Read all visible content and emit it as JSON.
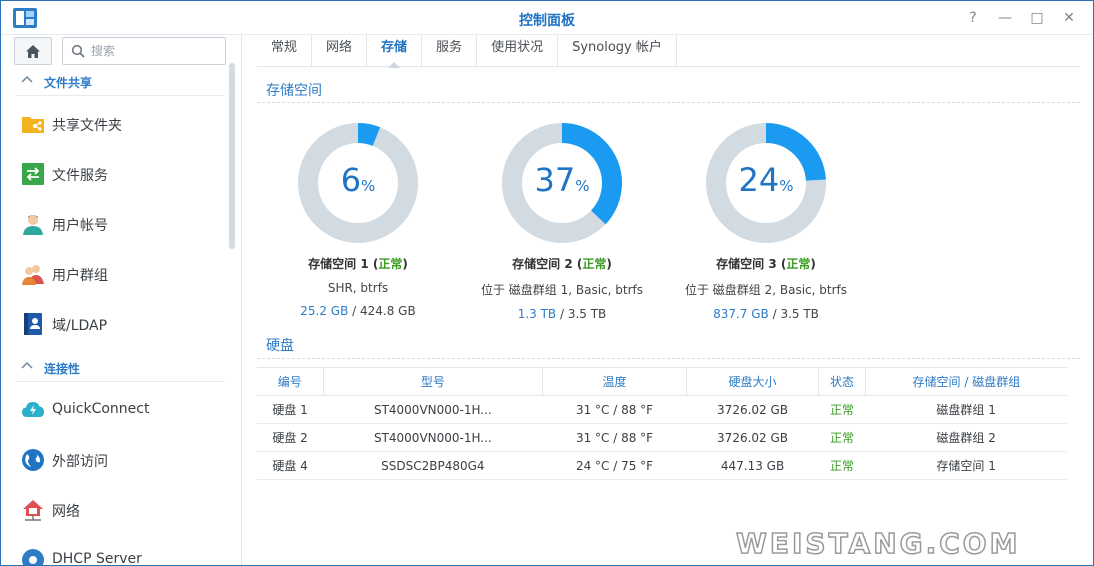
{
  "window": {
    "title": "控制面板",
    "buttons": {
      "help": "?",
      "minimize": "—",
      "maximize": "□",
      "close": "✕"
    }
  },
  "sidebar": {
    "search_placeholder": "搜索",
    "sections": [
      {
        "label": "文件共享"
      },
      {
        "label": "连接性"
      }
    ],
    "items": [
      {
        "label": "共享文件夹",
        "icon": "shared-folder-icon"
      },
      {
        "label": "文件服务",
        "icon": "file-services-icon"
      },
      {
        "label": "用户帐号",
        "icon": "user-icon"
      },
      {
        "label": "用户群组",
        "icon": "group-icon"
      },
      {
        "label": "域/LDAP",
        "icon": "ldap-icon"
      },
      {
        "label": "QuickConnect",
        "icon": "quickconnect-icon"
      },
      {
        "label": "外部访问",
        "icon": "external-access-icon"
      },
      {
        "label": "网络",
        "icon": "network-icon"
      },
      {
        "label": "DHCP Server",
        "icon": "dhcp-icon"
      }
    ]
  },
  "tabs": [
    "常规",
    "网络",
    "存储",
    "服务",
    "使用状况",
    "Synology 帐户"
  ],
  "active_tab": "存储",
  "storage": {
    "section_title": "存储空间",
    "volumes": [
      {
        "percent": 6,
        "unit": "%",
        "name": "存储空间 1",
        "status": "正常",
        "desc": "SHR, btrfs",
        "used": "25.2 GB",
        "total": "424.8 GB"
      },
      {
        "percent": 37,
        "unit": "%",
        "name": "存储空间 2",
        "status": "正常",
        "desc": "位于 磁盘群组 1, Basic, btrfs",
        "used": "1.3 TB",
        "total": "3.5 TB"
      },
      {
        "percent": 24,
        "unit": "%",
        "name": "存储空间 3",
        "status": "正常",
        "desc": "位于 磁盘群组 2, Basic, btrfs",
        "used": "837.7 GB",
        "total": "3.5 TB"
      }
    ]
  },
  "disks": {
    "section_title": "硬盘",
    "columns": [
      "编号",
      "型号",
      "温度",
      "硬盘大小",
      "状态",
      "存储空间 / 磁盘群组"
    ],
    "rows": [
      [
        "硬盘 1",
        "ST4000VN000-1H...",
        "31 °C / 88 °F",
        "3726.02 GB",
        "正常",
        "磁盘群组 1"
      ],
      [
        "硬盘 2",
        "ST4000VN000-1H...",
        "31 °C / 88 °F",
        "3726.02 GB",
        "正常",
        "磁盘群组 2"
      ],
      [
        "硬盘 4",
        "SSDSC2BP480G4",
        "24 °C / 75 °F",
        "447.13 GB",
        "正常",
        "存储空间 1"
      ]
    ]
  },
  "colors": {
    "accent": "#1f74c4",
    "ring_used": "#1a9af0",
    "ring_free": "#d3dbe2",
    "ok": "#3a9b20"
  },
  "watermark": "WEISTANG.COM"
}
